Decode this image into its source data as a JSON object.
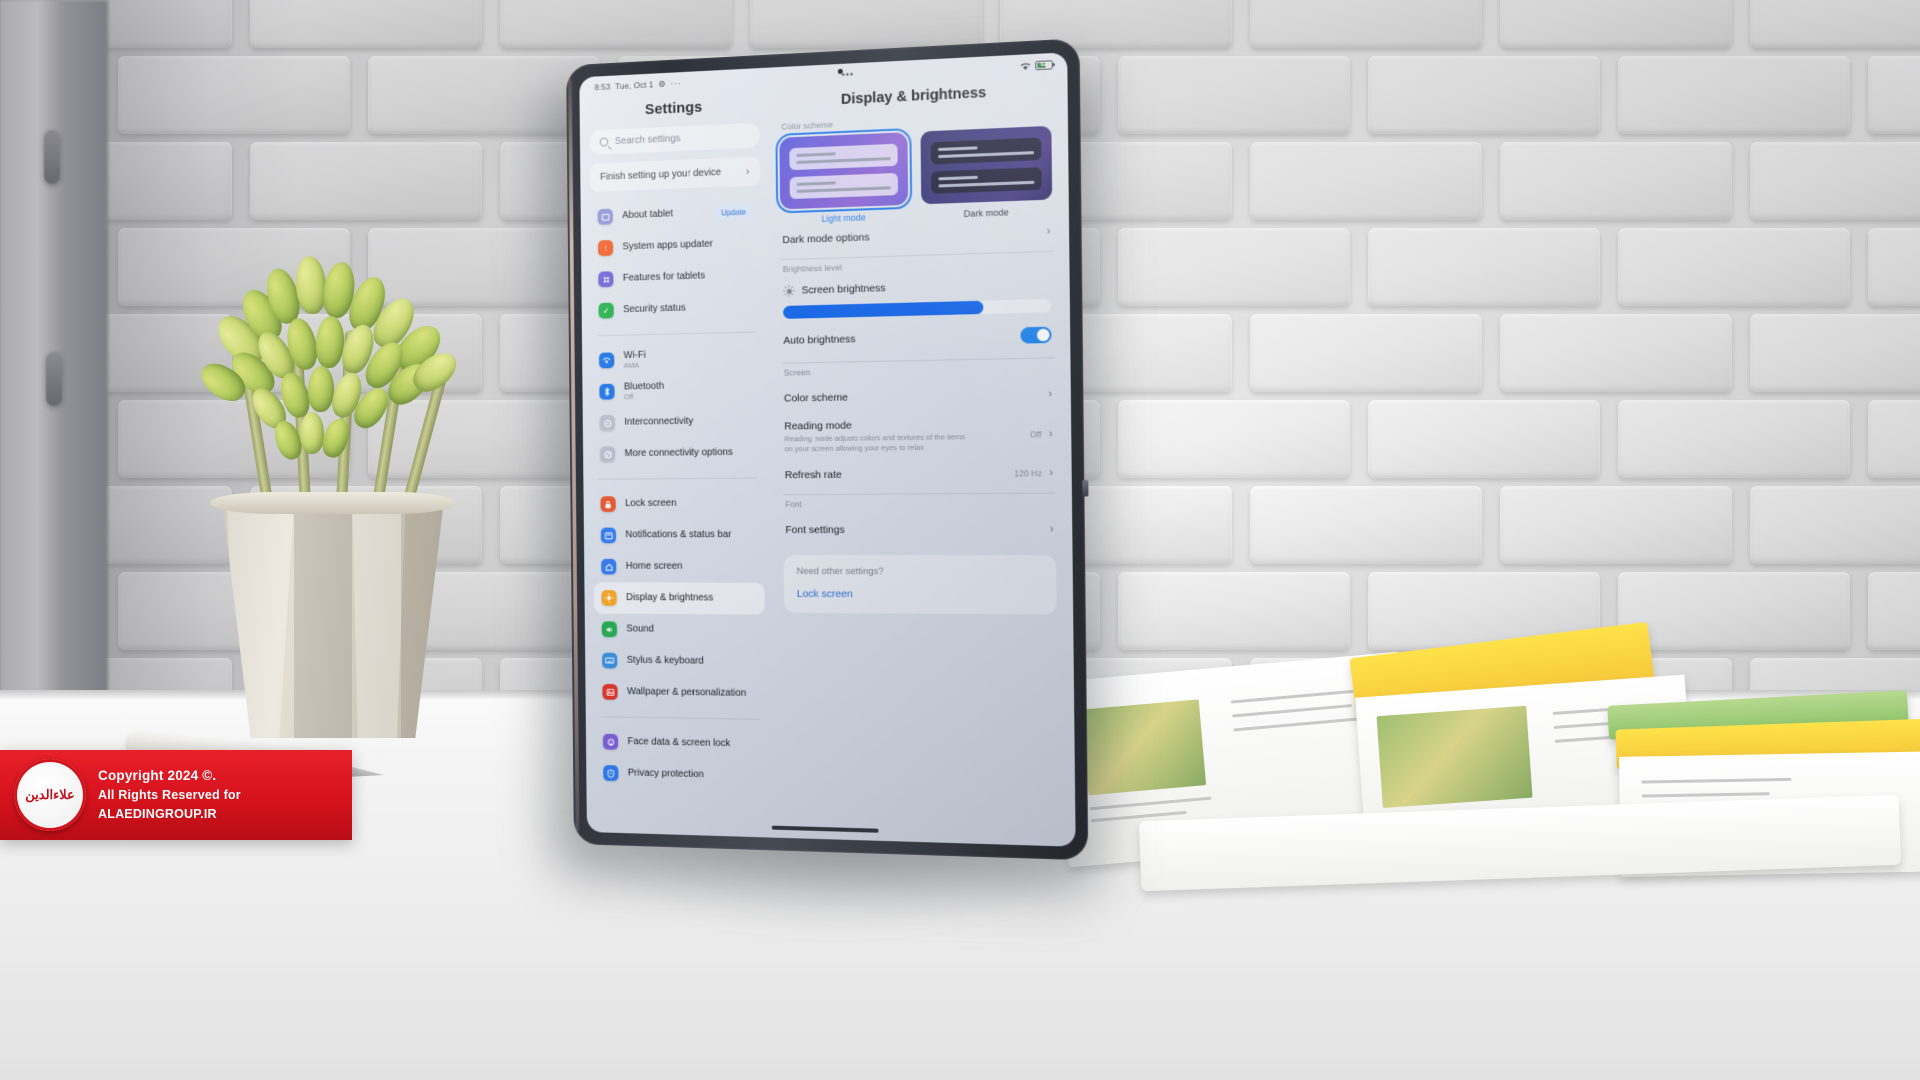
{
  "scene": {
    "description": "Photograph of a tablet propped on a white desk in front of a white 3D brick wall, with a succulent plant in a geometric concrete pot on the left, an open magazine on the right, and a pen on the desk."
  },
  "watermark": {
    "seal_text": "علاءالدین",
    "line1": "Copyright 2024 ©.",
    "line2": "All Rights Reserved for ALAEDINGROUP.IR"
  },
  "tablet": {
    "statusbar": {
      "time": "8:53",
      "date": "Tue, Oct 1",
      "gear_icon": "gear-icon",
      "left_dots": "···",
      "center_dots": "•••",
      "wifi_icon": "wifi-icon",
      "battery_level": "62"
    },
    "navbar": {
      "pill": "home-indicator"
    },
    "left_pane": {
      "title": "Settings",
      "search": {
        "placeholder": "Search settings",
        "icon": "search-icon"
      },
      "finish_card": {
        "label": "Finish setting up your device",
        "chevron": "chevron-right-icon"
      },
      "groups": [
        {
          "items": [
            {
              "label": "About tablet",
              "icon": "tablet-icon",
              "icon_color": "#8a8fd4",
              "badge": "Update"
            },
            {
              "label": "System apps updater",
              "icon": "up-arrow-icon",
              "icon_color": "#ef5a22"
            },
            {
              "label": "Features for tablets",
              "icon": "grid-dots-icon",
              "icon_color": "#6a63d6"
            },
            {
              "label": "Security status",
              "icon": "shield-check-icon",
              "icon_color": "#22b14c"
            }
          ]
        },
        {
          "items": [
            {
              "label": "Wi-Fi",
              "sub": "AMA",
              "icon": "wifi-icon",
              "icon_color": "#1a73e8"
            },
            {
              "label": "Bluetooth",
              "sub": "Off",
              "icon": "bluetooth-icon",
              "icon_color": "#1a73e8"
            },
            {
              "label": "Interconnectivity",
              "icon": "interconnectivity-icon",
              "icon_color": "#b9c0cc"
            },
            {
              "label": "More connectivity options",
              "icon": "more-connectivity-icon",
              "icon_color": "#b9c0cc"
            }
          ]
        },
        {
          "items": [
            {
              "label": "Lock screen",
              "icon": "lock-icon",
              "icon_color": "#e8532a"
            },
            {
              "label": "Notifications & status bar",
              "icon": "notifications-icon",
              "icon_color": "#2f7bf0"
            },
            {
              "label": "Home screen",
              "icon": "home-icon",
              "icon_color": "#2f7bf0"
            },
            {
              "label": "Display & brightness",
              "icon": "sun-icon",
              "icon_color": "#f5a623",
              "selected": true
            },
            {
              "label": "Sound",
              "icon": "speaker-icon",
              "icon_color": "#23ab4f"
            },
            {
              "label": "Stylus & keyboard",
              "icon": "keyboard-icon",
              "icon_color": "#3a8fe0"
            },
            {
              "label": "Wallpaper & personalization",
              "icon": "wallpaper-icon",
              "icon_color": "#e0342c"
            }
          ]
        },
        {
          "items": [
            {
              "label": "Face data & screen lock",
              "icon": "face-unlock-icon",
              "icon_color": "#7b5fd8"
            },
            {
              "label": "Privacy protection",
              "icon": "privacy-icon",
              "icon_color": "#2f7bf0"
            }
          ]
        }
      ]
    },
    "right_pane": {
      "title": "Display & brightness",
      "color_scheme_label": "Color scheme",
      "themes": [
        {
          "name": "Light mode",
          "selected": true
        },
        {
          "name": "Dark mode",
          "selected": false
        }
      ],
      "dark_mode_options": {
        "label": "Dark mode options",
        "chevron": "chevron-right-icon"
      },
      "brightness_section": {
        "label": "Brightness level",
        "screen_brightness_label": "Screen brightness",
        "brightness_icon": "brightness-sun-icon",
        "brightness_percent": 75,
        "auto_brightness_label": "Auto brightness",
        "auto_brightness_on": true
      },
      "screen_section": {
        "label": "Screen",
        "rows": [
          {
            "title": "Color scheme",
            "value": "",
            "chevron": "chevron-right-icon"
          },
          {
            "title": "Reading mode",
            "desc": "Reading mode adjusts colors and textures of the items on your screen allowing your eyes to relax",
            "value": "Off",
            "chevron": "chevron-right-icon"
          },
          {
            "title": "Refresh rate",
            "value": "120 Hz",
            "chevron": "chevron-right-icon"
          }
        ]
      },
      "font_section": {
        "label": "Font",
        "rows": [
          {
            "title": "Font settings",
            "value": "",
            "chevron": "chevron-right-icon"
          }
        ]
      },
      "need_card": {
        "title": "Need other settings?",
        "link": "Lock screen"
      }
    }
  },
  "colors": {
    "accent_blue": "#1f7bf0",
    "slider_blue": "#1668ec",
    "badge_bg": "#dce7f8",
    "badge_text": "#2b6fd4",
    "watermark_red": "#d5121c"
  }
}
